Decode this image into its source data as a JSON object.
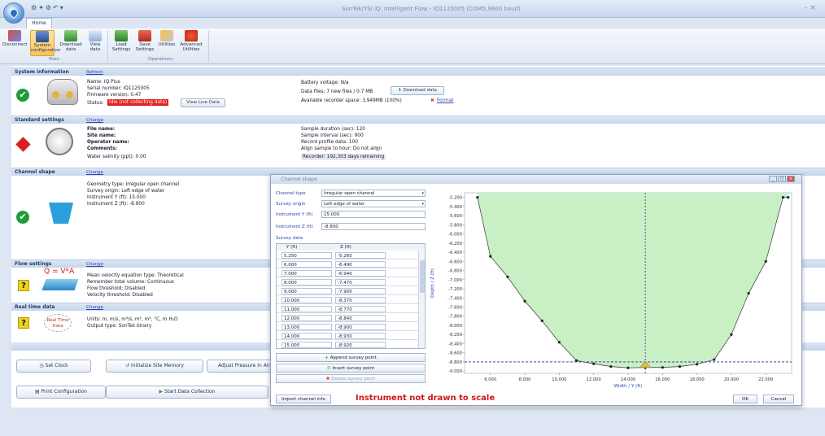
{
  "window": {
    "title": "SonTek/YSI iQ: Intelligent Flow - IQ1125005 (COM5,9600 baud)",
    "tab": "Home",
    "close_glyph": "–  ×"
  },
  "ribbon": {
    "main_buttons": [
      "Disconnect",
      "System configuration",
      "Download data",
      "View data"
    ],
    "operations_buttons": [
      "Load Settings",
      "Save Settings",
      "Utilities",
      "Advanced Utilities"
    ],
    "group_main": "Main",
    "group_operations": "Operations"
  },
  "system_info": {
    "header": "System information",
    "action": "Refresh",
    "name": "Name: IQ Plus",
    "serial": "Serial number: IQ1125005",
    "firmware": "Firmware version: 0.47",
    "status_label": "Status:",
    "status_value": "Idle (not collecting data)",
    "view_live": "View Live Data",
    "battery": "Battery voltage: N/a",
    "data_files": "Data files: 7 new files / 0.7 MB",
    "download_btn": "Download data",
    "recorder_space": "Available recorder space: 3,949MB (100%)",
    "format": "Format"
  },
  "standard_settings": {
    "header": "Standard settings",
    "action": "Change",
    "left": [
      "File name:",
      "Site name:",
      "Operator name:",
      "Comments:",
      "Water salinity (ppt): 0.00"
    ],
    "right": [
      "Sample duration (sec): 120",
      "Sample interval (sec): 900",
      "Record profile data: 100",
      "Align sample to hour: Do not align",
      "Recorder: 192,303 days remaining"
    ]
  },
  "channel_shape": {
    "header": "Channel shape",
    "action": "Change",
    "lines": [
      "Geometry type: Irregular open channel",
      "Survey origin: Left edge of water",
      "Instrument Y (ft): 15.000",
      "Instrument Z (ft): -8.800"
    ]
  },
  "flow_settings": {
    "header": "Flow settings",
    "action": "Change",
    "formula": "Q = V*A",
    "lines": [
      "Mean velocity equation type: Theoretical",
      "Remember total volume: Continuous",
      "Flow threshold: Disabled",
      "Velocity threshold: Disabled"
    ]
  },
  "real_time": {
    "header": "Real time data",
    "action": "Change",
    "icon_label": "Real Time Data",
    "lines": [
      "Units: m, m/s, m³/s, m², m³, °C, m H₂O",
      "Output type: SonTek binary"
    ]
  },
  "bottom_buttons": {
    "set_clock": "Set Clock",
    "init_memory": "Initialize Site Memory",
    "adjust_pressure": "Adjust Pressure In Air",
    "print_config": "Print Configuration",
    "start_collection": "Start Data Collection"
  },
  "dialog": {
    "title": "Channel shape",
    "channel_type_label": "Channel type",
    "channel_type_value": "Irregular open channel",
    "survey_origin_label": "Survey origin",
    "survey_origin_value": "Left edge of water",
    "instr_y_label": "Instrument Y (ft)",
    "instr_y_value": "15.000",
    "instr_z_label": "Instrument Z (ft)",
    "instr_z_value": "-8.800",
    "survey_data_label": "Survey data",
    "col_y": "Y (ft)",
    "col_z": "Z (ft)",
    "rows": [
      [
        "5.250",
        "-5.260"
      ],
      [
        "6.000",
        "-6.490"
      ],
      [
        "7.000",
        "-6.940"
      ],
      [
        "8.000",
        "-7.470"
      ],
      [
        "9.000",
        "-7.900"
      ],
      [
        "10.000",
        "-8.370"
      ],
      [
        "11.000",
        "-8.770"
      ],
      [
        "12.000",
        "-8.840"
      ],
      [
        "13.000",
        "-8.900"
      ],
      [
        "14.000",
        "-8.930"
      ],
      [
        "15.000",
        "-8.920"
      ]
    ],
    "append": "Append survey point",
    "insert": "Insert survey point",
    "delete": "Delete survey point",
    "import": "Import channel info",
    "note": "Instrument not drawn to scale",
    "ok": "OK",
    "cancel": "Cancel"
  },
  "chart_data": {
    "type": "area",
    "xlabel": "Width / Y (ft)",
    "ylabel": "Depth / Z (ft)",
    "xlim": [
      4.5,
      23.5
    ],
    "ylim": [
      -9.05,
      -5.1
    ],
    "xticks": [
      "6.000",
      "8.000",
      "10.000",
      "12.000",
      "14.000",
      "16.000",
      "18.000",
      "20.000",
      "22.000"
    ],
    "yticks": [
      "-5.200",
      "-5.400",
      "-5.600",
      "-5.800",
      "-6.000",
      "-6.200",
      "-6.400",
      "-6.600",
      "-6.800",
      "-7.000",
      "-7.200",
      "-7.400",
      "-7.600",
      "-7.800",
      "-8.000",
      "-8.200",
      "-8.400",
      "-8.600",
      "-8.800",
      "-9.000"
    ],
    "x": [
      5.25,
      6,
      7,
      8,
      9,
      10,
      11,
      12,
      13,
      14,
      15,
      16,
      17,
      18,
      19,
      20,
      21,
      22,
      23,
      23.3
    ],
    "y": [
      -5.2,
      -6.49,
      -6.94,
      -7.47,
      -7.9,
      -8.37,
      -8.77,
      -8.84,
      -8.9,
      -8.93,
      -8.92,
      -8.92,
      -8.9,
      -8.85,
      -8.75,
      -8.2,
      -7.3,
      -6.6,
      -5.2,
      -5.2
    ],
    "instrument_y": 15.0,
    "instrument_z": -8.8,
    "fill_color": "#c9f0c4",
    "line_color": "#4a4a4a"
  }
}
